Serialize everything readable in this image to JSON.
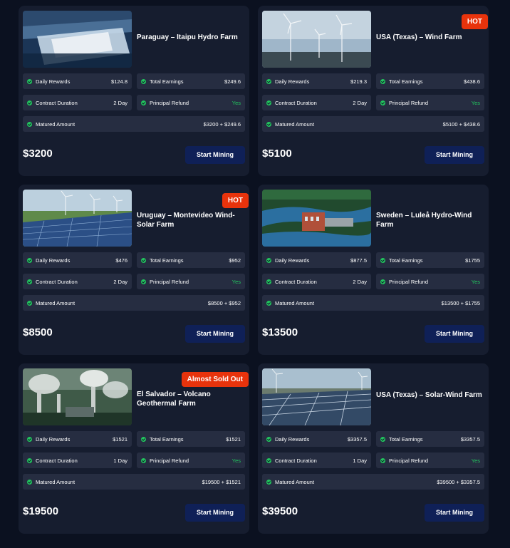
{
  "labels": {
    "daily_rewards": "Daily Rewards",
    "total_earnings": "Total Earnings",
    "contract_duration": "Contract Duration",
    "principal_refund": "Principal Refund",
    "matured_amount": "Matured Amount",
    "button": "Start Mining"
  },
  "colors": {
    "page_bg": "#0b1120",
    "card_bg": "#161d2f",
    "stat_bg": "#262d41",
    "badge_red": "#e8330c",
    "yes_green": "#22c55e",
    "button_navy": "#0f2057"
  },
  "cards": [
    {
      "title": "Paraguay – Itaipu Hydro Farm",
      "badge": "",
      "image": "dam-waterfall-image",
      "daily_rewards": "$124.8",
      "total_earnings": "$249.6",
      "contract_duration": "2 Day",
      "principal_refund": "Yes",
      "matured_amount": "$3200 + $249.6",
      "price": "$3200"
    },
    {
      "title": "USA (Texas) – Wind Farm",
      "badge": "HOT",
      "image": "wind-turbines-image",
      "daily_rewards": "$219.3",
      "total_earnings": "$438.6",
      "contract_duration": "2 Day",
      "principal_refund": "Yes",
      "matured_amount": "$5100 + $438.6",
      "price": "$5100"
    },
    {
      "title": "Uruguay – Montevideo Wind-Solar Farm",
      "badge": "HOT",
      "image": "solar-panels-turbines-image",
      "daily_rewards": "$476",
      "total_earnings": "$952",
      "contract_duration": "2 Day",
      "principal_refund": "Yes",
      "matured_amount": "$8500 + $952",
      "price": "$8500"
    },
    {
      "title": "Sweden – Luleå Hydro-Wind Farm",
      "badge": "",
      "image": "hydro-plant-river-image",
      "daily_rewards": "$877.5",
      "total_earnings": "$1755",
      "contract_duration": "2 Day",
      "principal_refund": "Yes",
      "matured_amount": "$13500 + $1755",
      "price": "$13500"
    },
    {
      "title": "El Salvador – Volcano Geothermal Farm",
      "badge": "Almost Sold Out",
      "image": "geothermal-plant-steam-image",
      "daily_rewards": "$1521",
      "total_earnings": "$1521",
      "contract_duration": "1 Day",
      "principal_refund": "Yes",
      "matured_amount": "$19500 + $1521",
      "price": "$19500"
    },
    {
      "title": "USA (Texas) – Solar-Wind Farm",
      "badge": "",
      "image": "solar-field-turbines-image",
      "daily_rewards": "$3357.5",
      "total_earnings": "$3357.5",
      "contract_duration": "1 Day",
      "principal_refund": "Yes",
      "matured_amount": "$39500 + $3357.5",
      "price": "$39500"
    }
  ]
}
